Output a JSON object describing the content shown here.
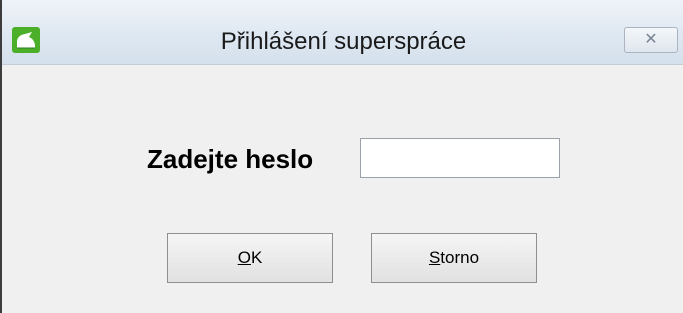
{
  "window": {
    "title": "Přihlášení superspráce",
    "close_glyph": "✕"
  },
  "form": {
    "prompt": "Zadejte heslo",
    "password_value": ""
  },
  "buttons": {
    "ok": {
      "access_key": "O",
      "rest": "K"
    },
    "cancel": {
      "access_key": "S",
      "rest": "torno"
    }
  },
  "colors": {
    "app_icon_green": "#4caf2a",
    "titlebar": "#dde7f1",
    "dialog_background": "#f0f0f0"
  },
  "icons": {
    "app": "app-logo-icon",
    "close": "close-icon"
  }
}
